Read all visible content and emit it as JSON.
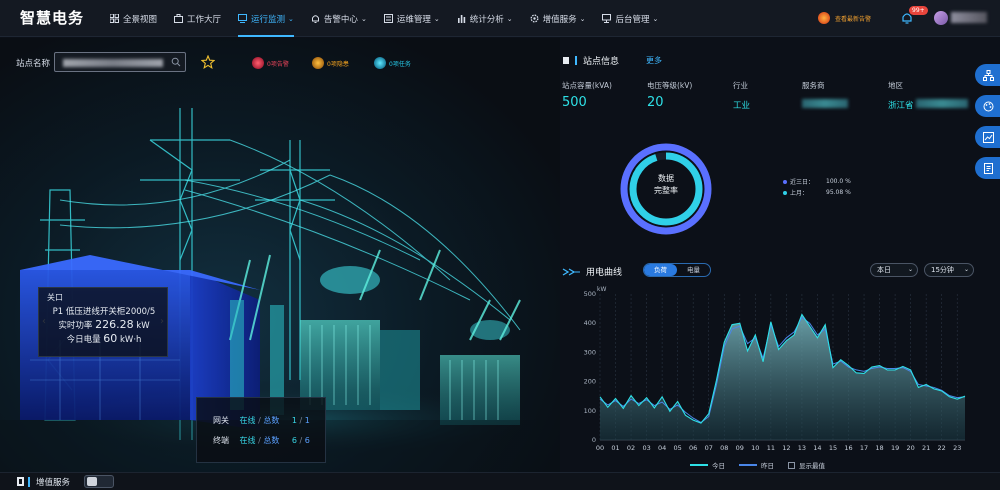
{
  "header": {
    "logo": "智慧电务",
    "nav": [
      {
        "label": "全景视图",
        "icon": "grid-icon",
        "dropdown": false,
        "active": false
      },
      {
        "label": "工作大厅",
        "icon": "briefcase-icon",
        "dropdown": false,
        "active": false
      },
      {
        "label": "运行监测",
        "icon": "monitor-icon",
        "dropdown": true,
        "active": true
      },
      {
        "label": "告警中心",
        "icon": "bell-icon",
        "dropdown": true,
        "active": false
      },
      {
        "label": "运维管理",
        "icon": "list-icon",
        "dropdown": true,
        "active": false
      },
      {
        "label": "统计分析",
        "icon": "bar-chart-icon",
        "dropdown": true,
        "active": false
      },
      {
        "label": "增值服务",
        "icon": "gear-icon",
        "dropdown": true,
        "active": false
      },
      {
        "label": "后台管理",
        "icon": "desktop-icon",
        "dropdown": true,
        "active": false
      }
    ],
    "alarm_link": "查看最新告警",
    "notification_badge": "99+",
    "accent_color": "#3fb8ff"
  },
  "station": {
    "label": "站点名称",
    "pills": [
      {
        "label": "0项告警",
        "color": "#e8455a"
      },
      {
        "label": "0项隐患",
        "color": "#f0a020"
      },
      {
        "label": "0项任务",
        "color": "#26c8e8"
      }
    ]
  },
  "switch_panel": {
    "close": "关口",
    "name": "P1 低压进线开关柜2000/5",
    "power_label": "实时功率",
    "power_value": "226.28",
    "power_unit": "kW",
    "energy_label": "今日电量",
    "energy_value": "60",
    "energy_unit": "kW·h"
  },
  "devices": {
    "online_label": "在线",
    "total_label": "总数",
    "rows": [
      {
        "name": "网关",
        "online": "1",
        "total": "1"
      },
      {
        "name": "终端",
        "online": "6",
        "total": "6"
      }
    ]
  },
  "bottom_bar": {
    "title": "增值服务"
  },
  "site_info": {
    "title": "站点信息",
    "more": "更多",
    "fields": [
      {
        "label": "站点容量(kVA)",
        "value": "500",
        "style": "large"
      },
      {
        "label": "电压等级(kV)",
        "value": "20",
        "style": "large"
      },
      {
        "label": "行业",
        "value": "工业",
        "style": "small"
      },
      {
        "label": "服务商",
        "value": "",
        "style": "blurred"
      },
      {
        "label": "地区",
        "value": "浙江省",
        "style": "small"
      }
    ]
  },
  "completeness": {
    "ring_line1": "数据",
    "ring_line2": "完整率",
    "items": [
      {
        "label": "近三日：",
        "value": "100.0 %",
        "color": "#5a70ff",
        "fraction": 1.0
      },
      {
        "label": "上月：",
        "value": "95.08 %",
        "color": "#30d0e8",
        "fraction": 0.9508
      }
    ]
  },
  "curve": {
    "title": "用电曲线",
    "tabs": [
      "负荷",
      "电量"
    ],
    "active_tab": "负荷",
    "period_select": "本日",
    "interval_select": "15分钟",
    "legend": [
      "今日",
      "昨日"
    ],
    "checkbox_label": "显示最值"
  },
  "side_buttons": [
    "org-chart-icon",
    "palette-icon",
    "chart-icon",
    "document-icon"
  ],
  "chart_data": {
    "type": "area",
    "title": "",
    "xlabel": "",
    "ylabel": "kW",
    "ylim": [
      0,
      500
    ],
    "yticks": [
      0,
      100,
      200,
      300,
      400,
      500
    ],
    "xlim": [
      0,
      23.5
    ],
    "x_tick_labels": [
      "00",
      "01",
      "02",
      "03",
      "04",
      "05",
      "06",
      "07",
      "08",
      "09",
      "10",
      "11",
      "12",
      "13",
      "14",
      "15",
      "16",
      "17",
      "18",
      "19",
      "20",
      "21",
      "22",
      "23"
    ],
    "grid": "vertical dashed",
    "series": [
      {
        "name": "今日",
        "color": "#2ee0e6",
        "x": [
          0,
          0.5,
          1,
          1.5,
          2,
          2.5,
          3,
          3.5,
          4,
          4.5,
          5,
          5.5,
          6,
          6.5,
          7,
          7.5,
          8,
          8.5,
          9,
          9.5,
          10,
          10.5,
          11,
          11.5,
          12,
          12.5,
          13,
          13.5,
          14,
          14.5,
          15,
          15.5,
          16,
          16.5,
          17,
          17.5,
          18,
          18.5,
          19,
          19.5,
          20,
          20.5,
          21,
          21.5,
          22,
          22.5,
          23,
          23.5
        ],
        "values": [
          148,
          112,
          142,
          108,
          152,
          118,
          145,
          110,
          148,
          98,
          132,
          85,
          68,
          58,
          90,
          205,
          335,
          395,
          400,
          305,
          360,
          268,
          405,
          310,
          340,
          360,
          430,
          390,
          350,
          395,
          248,
          275,
          255,
          230,
          228,
          250,
          255,
          240,
          240,
          252,
          240,
          180,
          190,
          175,
          168,
          148,
          140,
          150
        ]
      },
      {
        "name": "昨日",
        "color": "#4a86e8",
        "x": [
          0,
          0.5,
          1,
          1.5,
          2,
          2.5,
          3,
          3.5,
          4,
          4.5,
          5,
          5.5,
          6,
          6.5,
          7,
          7.5,
          8,
          8.5,
          9,
          9.5,
          10,
          10.5,
          11,
          11.5,
          12,
          12.5,
          13,
          13.5,
          14,
          14.5,
          15,
          15.5,
          16,
          16.5,
          17,
          17.5,
          18,
          18.5,
          19,
          19.5,
          20,
          20.5,
          21,
          21.5,
          22,
          22.5,
          23,
          23.5
        ],
        "values": [
          140,
          120,
          135,
          115,
          140,
          125,
          138,
          118,
          130,
          105,
          120,
          95,
          75,
          60,
          80,
          190,
          320,
          380,
          390,
          330,
          350,
          280,
          395,
          320,
          350,
          370,
          420,
          400,
          360,
          380,
          260,
          270,
          250,
          240,
          235,
          245,
          250,
          245,
          245,
          248,
          235,
          190,
          185,
          180,
          170,
          152,
          145,
          148
        ]
      }
    ]
  }
}
